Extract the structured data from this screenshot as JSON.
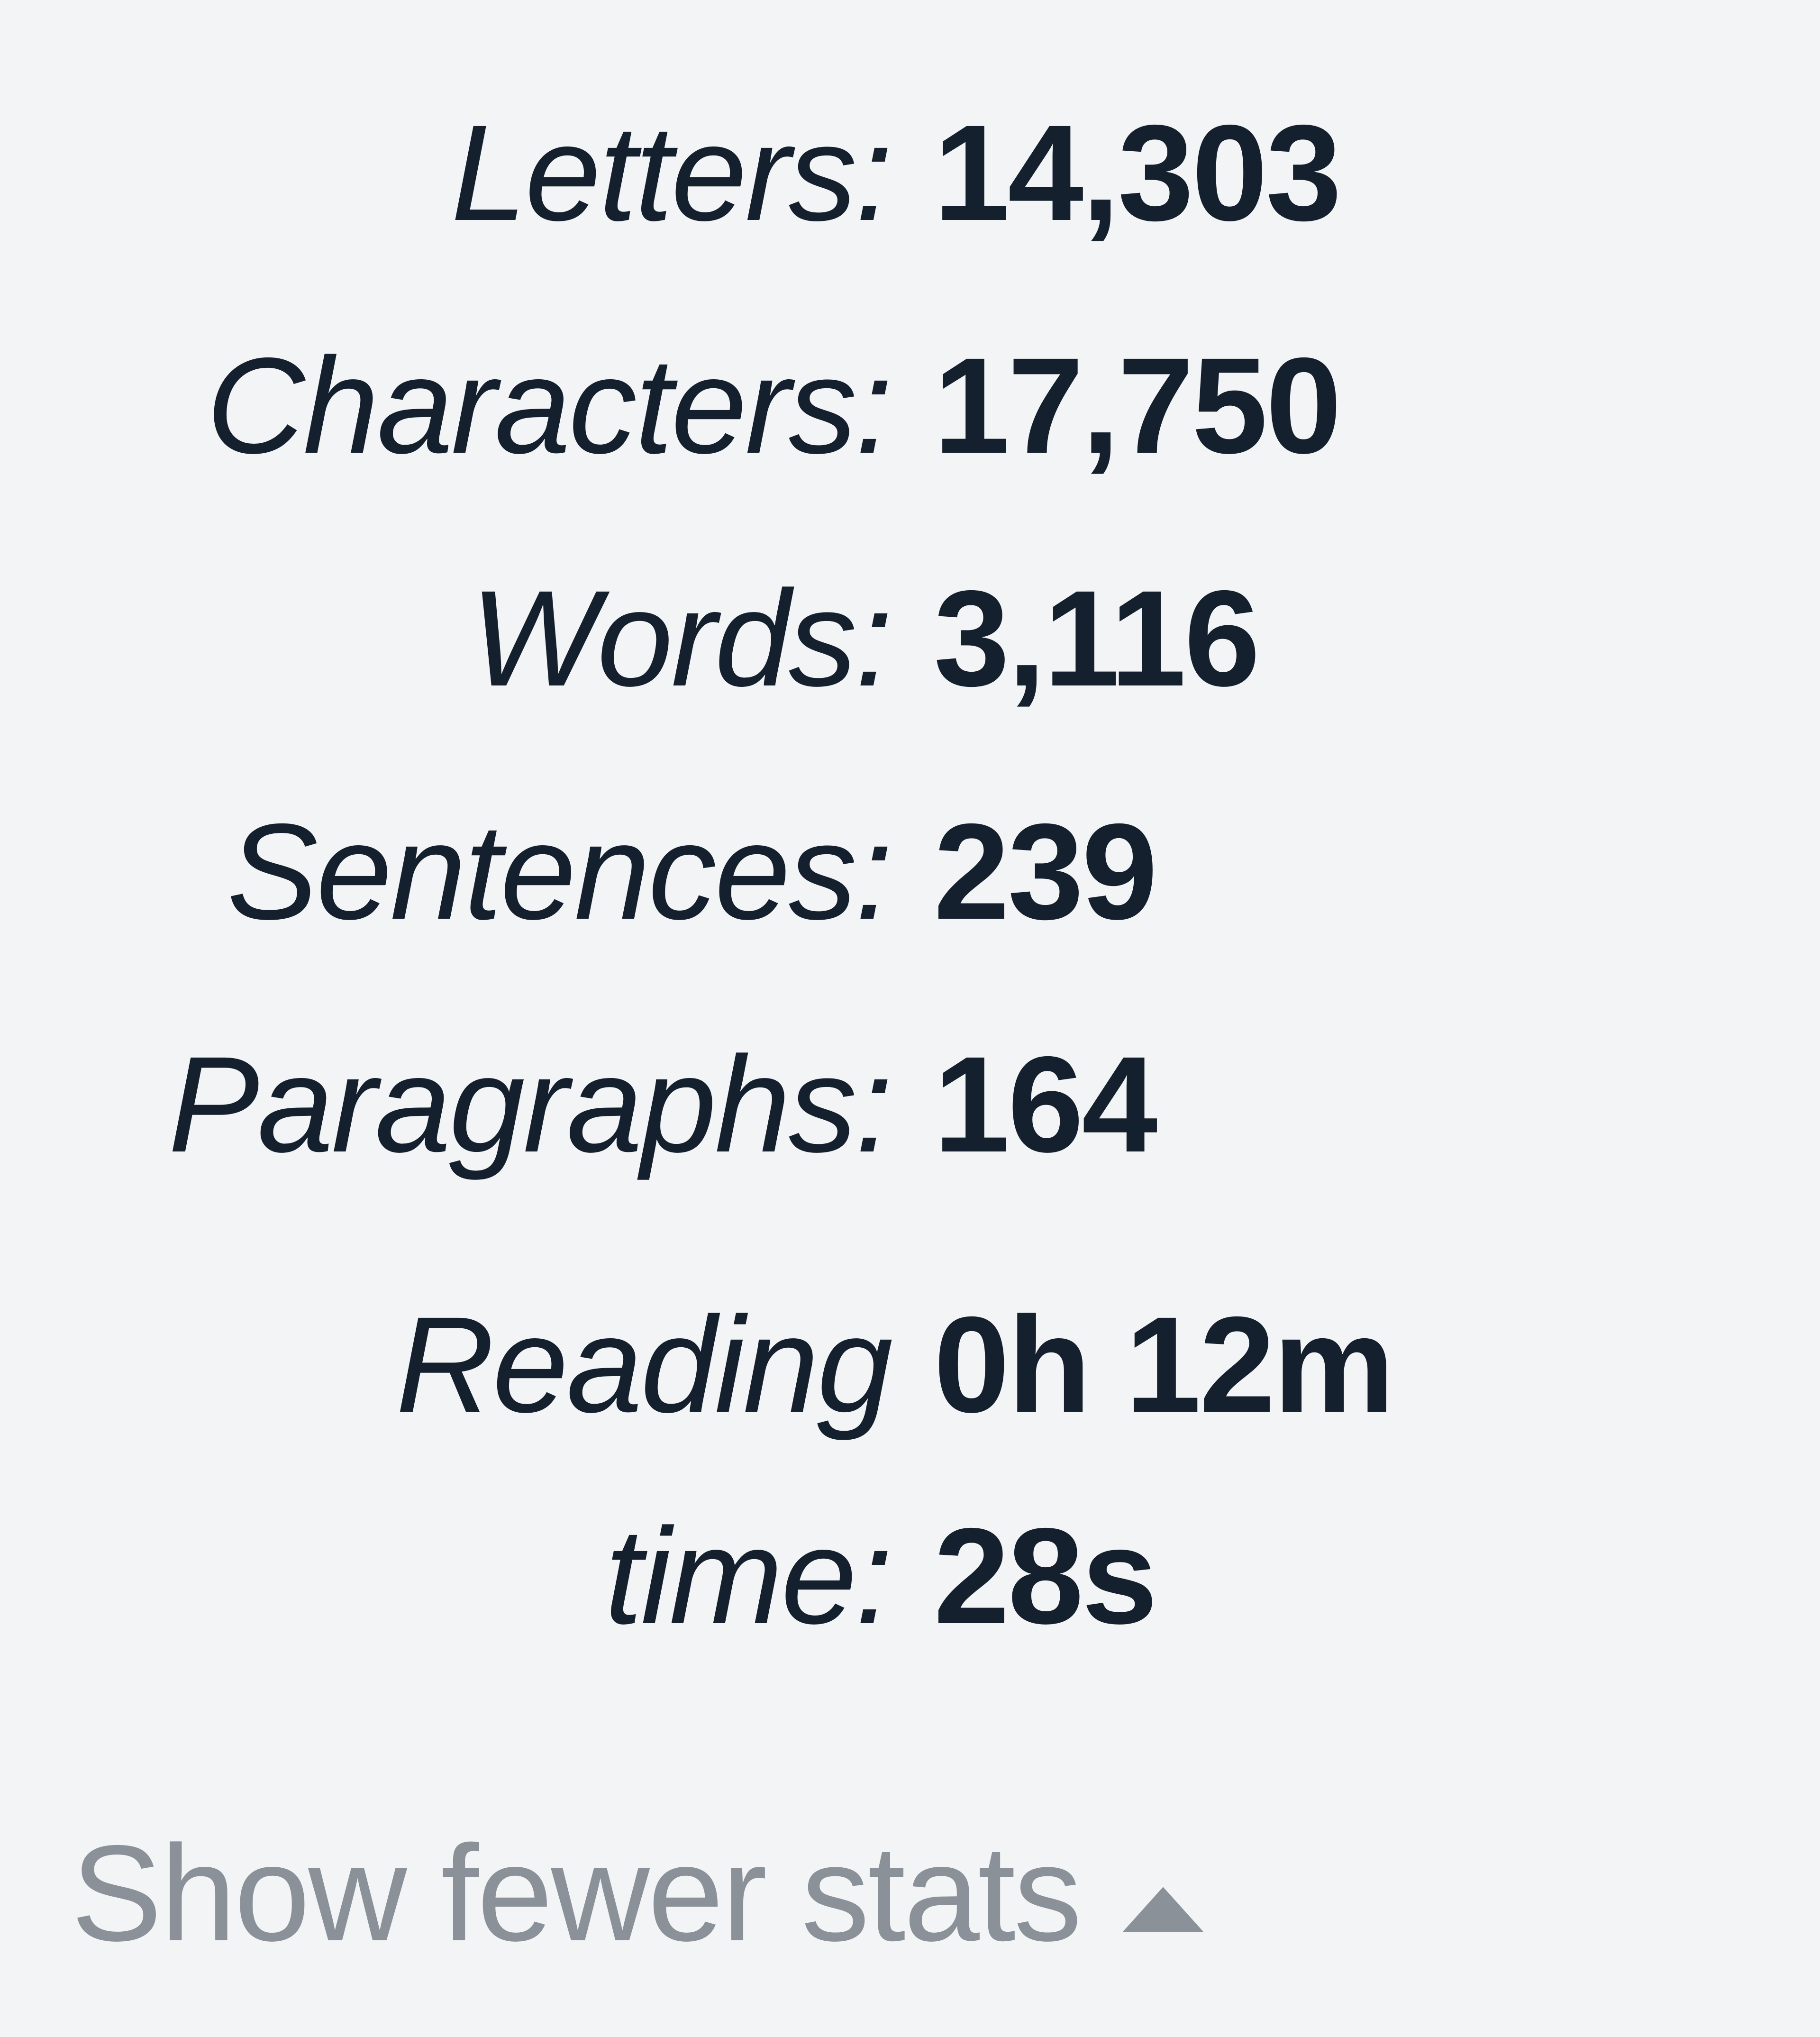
{
  "stats": {
    "letters": {
      "label": "Letters:",
      "value": "14,303"
    },
    "characters": {
      "label": "Characters:",
      "value": "17,750"
    },
    "words": {
      "label": "Words:",
      "value": "3,116"
    },
    "sentences": {
      "label": "Sentences:",
      "value": "239"
    },
    "paragraphs": {
      "label": "Paragraphs:",
      "value": "164"
    },
    "reading_time": {
      "label_line1": "Reading",
      "label_line2": "time:",
      "value_line1": "0h 12m",
      "value_line2": "28s"
    }
  },
  "toggle": {
    "label": "Show fewer stats"
  }
}
